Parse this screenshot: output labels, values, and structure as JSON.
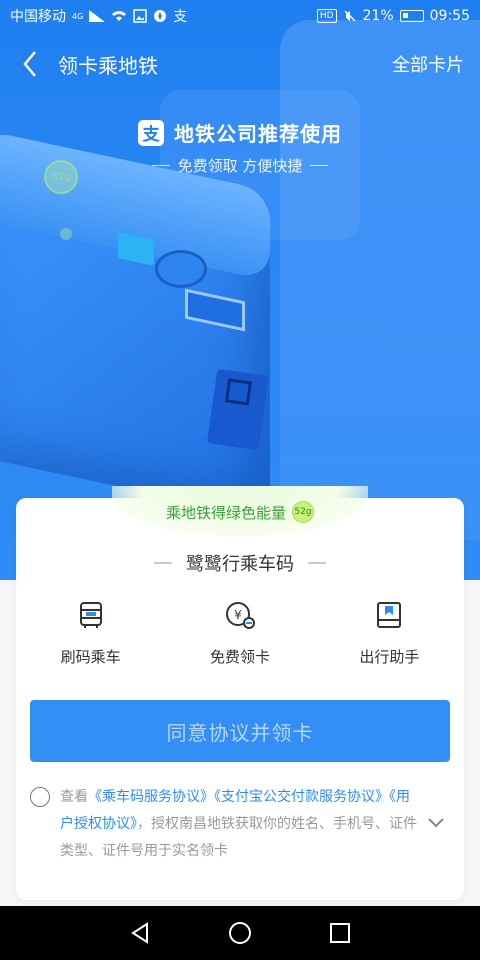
{
  "status_bar": {
    "carrier": "中国移动",
    "network": "4G",
    "hd": "HD",
    "battery": "21%",
    "time": "09:55"
  },
  "header": {
    "title": "领卡乘地铁",
    "right_action": "全部卡片"
  },
  "promo": {
    "title": "地铁公司推荐使用",
    "subtitle": "免费领取 方便快捷",
    "bubble_energy": "52g",
    "logo_glyph": "支"
  },
  "card": {
    "energy_text": "乘地铁得绿色能量",
    "energy_badge": "52g",
    "title": "鹭鹭行乘车码",
    "features": [
      {
        "label": "刷码乘车",
        "icon": "bus-icon"
      },
      {
        "label": "免费领卡",
        "icon": "free-card-icon"
      },
      {
        "label": "出行助手",
        "icon": "travel-assistant-icon"
      }
    ],
    "agree_button": "同意协议并领卡",
    "agreement": {
      "prefix": "查看",
      "links": [
        "《乘车码服务协议》",
        "《支付宝公交付款服务协议》",
        "《用户授权协议》"
      ],
      "suffix": "，授权南昌地铁获取你的姓名、手机号、证件类型、证件号用于实名领卡"
    }
  },
  "colors": {
    "primary": "#2f8cf5",
    "hero": "#1f7ff0",
    "energy_green": "#3aa33a"
  }
}
